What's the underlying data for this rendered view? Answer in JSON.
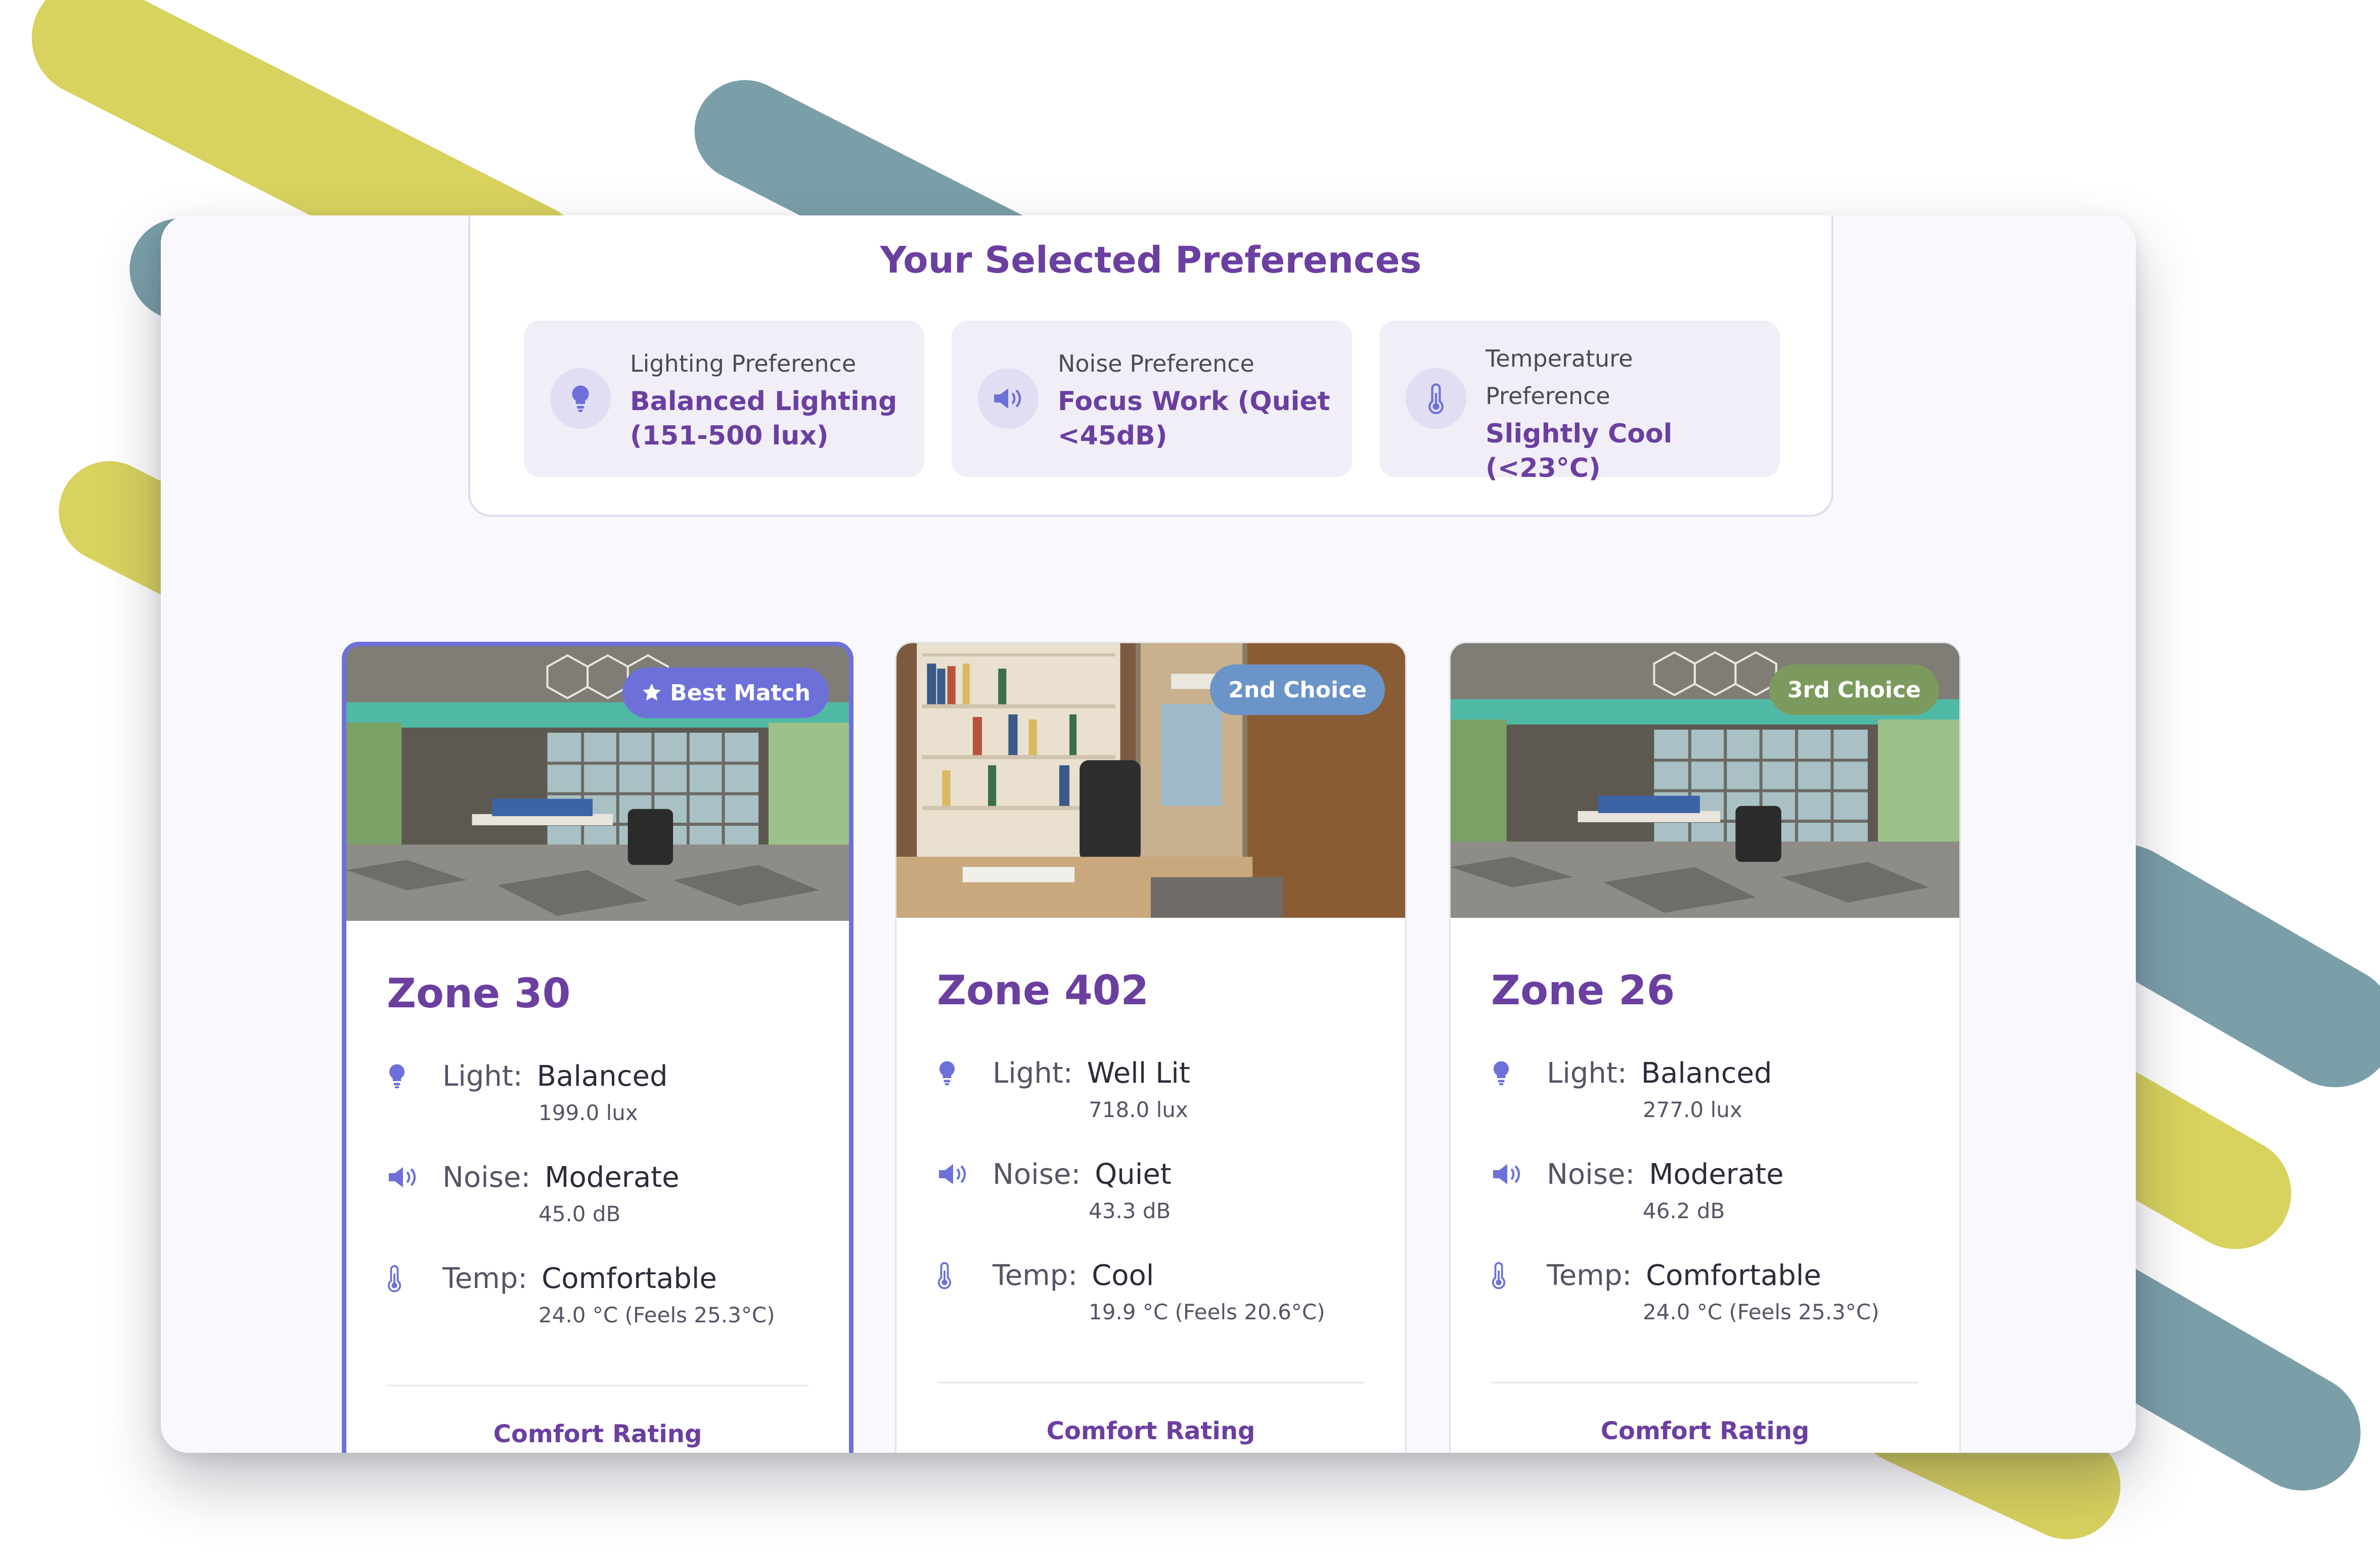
{
  "preferences": {
    "title": "Your Selected Preferences",
    "items": [
      {
        "label": "Lighting Preference",
        "value": "Balanced Lighting (151-500 lux)",
        "icon": "bulb-icon"
      },
      {
        "label": "Noise Preference",
        "value": "Focus Work (Quiet <45dB)",
        "icon": "speaker-icon"
      },
      {
        "label": "Temperature Preference",
        "value": "Slightly Cool (<23°C)",
        "icon": "thermometer-icon"
      }
    ]
  },
  "zones": [
    {
      "name": "Zone 30",
      "badge": "Best Match",
      "badge_color": "#6e70da",
      "light_label": "Light:",
      "light_level": "Balanced",
      "light_value": "199.0 lux",
      "noise_label": "Noise:",
      "noise_level": "Moderate",
      "noise_value": "45.0 dB",
      "temp_label": "Temp:",
      "temp_level": "Comfortable",
      "temp_value": "24.0 °C (Feels 25.3°C)",
      "footer": "Comfort Rating"
    },
    {
      "name": "Zone 402",
      "badge": "2nd Choice",
      "badge_color": "#6b94c8",
      "light_label": "Light:",
      "light_level": "Well Lit",
      "light_value": "718.0 lux",
      "noise_label": "Noise:",
      "noise_level": "Quiet",
      "noise_value": "43.3 dB",
      "temp_label": "Temp:",
      "temp_level": "Cool",
      "temp_value": "19.9 °C (Feels 20.6°C)",
      "footer": "Comfort Rating"
    },
    {
      "name": "Zone 26",
      "badge": "3rd Choice",
      "badge_color": "#7d9a5e",
      "light_label": "Light:",
      "light_level": "Balanced",
      "light_value": "277.0 lux",
      "noise_label": "Noise:",
      "noise_level": "Moderate",
      "noise_value": "46.2 dB",
      "temp_label": "Temp:",
      "temp_level": "Comfortable",
      "temp_value": "24.0 °C (Feels 25.3°C)",
      "footer": "Comfort Rating"
    }
  ],
  "colors": {
    "accent_purple": "#6b3fa0",
    "icon_blue": "#6e70da",
    "stripe_yellow": "#d8d25e",
    "stripe_teal": "#7a9fa8"
  }
}
